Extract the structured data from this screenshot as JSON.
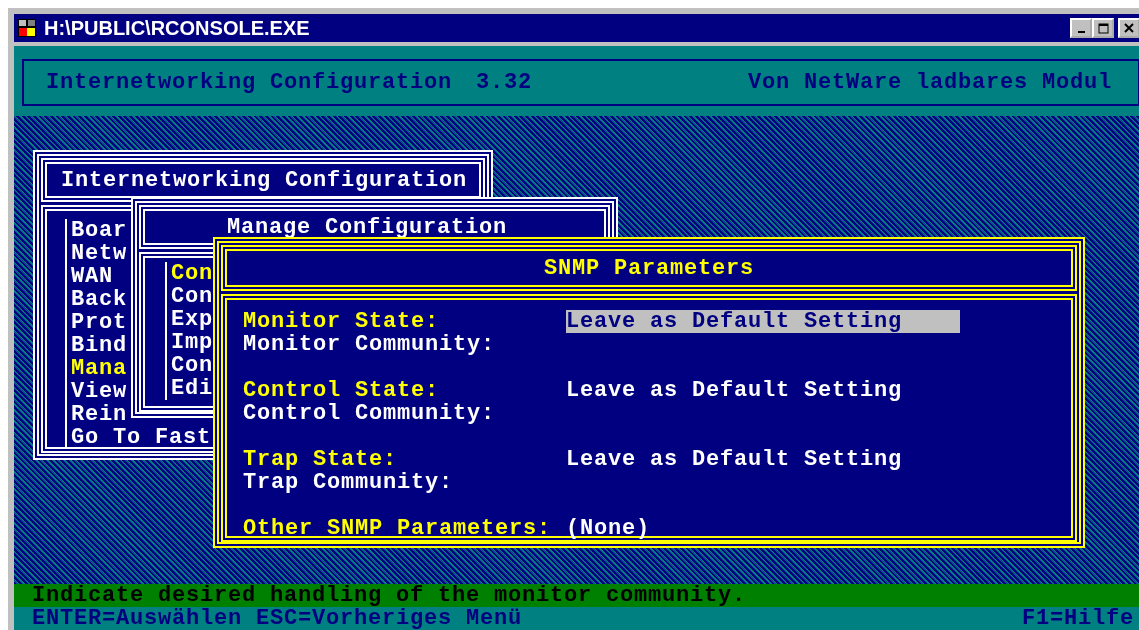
{
  "window": {
    "title": "H:\\PUBLIC\\RCONSOLE.EXE"
  },
  "header": {
    "title": "Internetworking Configuration",
    "version": "3.32",
    "subtitle": "Von NetWare ladbares Modul"
  },
  "main_menu": {
    "title": "Internetworking Configuration",
    "items": [
      {
        "label": "Boar",
        "selected": false
      },
      {
        "label": "Netw",
        "selected": false
      },
      {
        "label": "WAN",
        "selected": false
      },
      {
        "label": "Back",
        "selected": false
      },
      {
        "label": "Prot",
        "selected": false
      },
      {
        "label": "Bind",
        "selected": false
      },
      {
        "label": "Mana",
        "selected": true
      },
      {
        "label": "View",
        "selected": false
      },
      {
        "label": "Rein",
        "selected": false
      },
      {
        "label": "Go To Fast",
        "selected": false
      }
    ]
  },
  "manage_menu": {
    "title": "Manage Configuration",
    "items": [
      {
        "label": "Con",
        "selected": true
      },
      {
        "label": "Con",
        "selected": false
      },
      {
        "label": "Exp",
        "selected": false
      },
      {
        "label": "Imp",
        "selected": false
      },
      {
        "label": "Con",
        "selected": false
      },
      {
        "label": "Edi",
        "selected": false
      }
    ]
  },
  "snmp_dialog": {
    "title": "SNMP Parameters",
    "sections": [
      {
        "rows": [
          {
            "kind": "state",
            "label": "Monitor State:",
            "value": "Leave as Default Setting",
            "selected": true
          },
          {
            "kind": "community",
            "label": "Monitor Community:"
          }
        ]
      },
      {
        "rows": [
          {
            "kind": "state",
            "label": "Control State:",
            "value": "Leave as Default Setting",
            "selected": false
          },
          {
            "kind": "community",
            "label": "Control Community:"
          }
        ]
      },
      {
        "rows": [
          {
            "kind": "state",
            "label": "Trap State:",
            "value": "Leave as Default Setting",
            "selected": false
          },
          {
            "kind": "community",
            "label": "Trap Community:"
          }
        ]
      },
      {
        "rows": [
          {
            "kind": "other",
            "label": "Other SNMP Parameters:",
            "value": "(None)",
            "selected": false
          }
        ]
      }
    ]
  },
  "status_bar": {
    "hint": "Indicate desired handling of the monitor community.",
    "keys": [
      "ENTER=Auswählen",
      "ESC=Vorheriges Menü"
    ],
    "help": "F1=Hilfe"
  }
}
